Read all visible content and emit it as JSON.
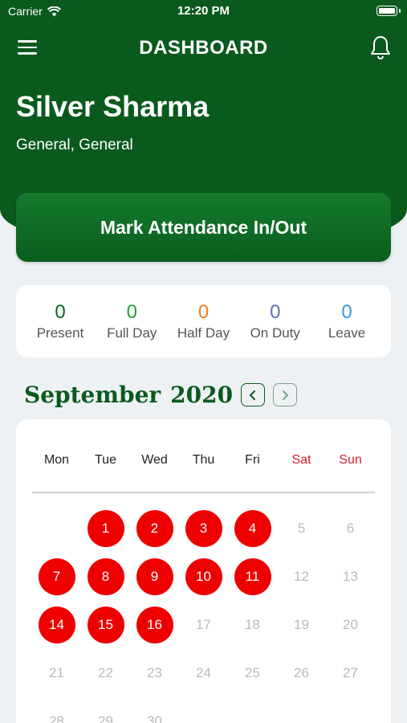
{
  "status_bar": {
    "carrier": "Carrier",
    "time": "12:20 PM"
  },
  "nav": {
    "title": "DASHBOARD",
    "menu_icon": "hamburger-menu-icon",
    "notify_icon": "bell-icon"
  },
  "user": {
    "name": "Silver Sharma",
    "subtitle": "General,  General"
  },
  "attendance_button": "Mark Attendance In/Out",
  "stats": [
    {
      "value": "0",
      "label": "Present",
      "color": "#0a6b22"
    },
    {
      "value": "0",
      "label": "Full Day",
      "color": "#1aa33a"
    },
    {
      "value": "0",
      "label": "Half Day",
      "color": "#f07d1a"
    },
    {
      "value": "0",
      "label": "On Duty",
      "color": "#5a6fbf"
    },
    {
      "value": "0",
      "label": "Leave",
      "color": "#3a9bd8"
    }
  ],
  "calendar": {
    "month_label": "September",
    "year_label": "2020",
    "weekdays": [
      "Mon",
      "Tue",
      "Wed",
      "Thu",
      "Fri",
      "Sat",
      "Sun"
    ],
    "weeks": [
      [
        "",
        "1",
        "2",
        "3",
        "4",
        "5",
        "6"
      ],
      [
        "7",
        "8",
        "9",
        "10",
        "11",
        "12",
        "13"
      ],
      [
        "14",
        "15",
        "16",
        "17",
        "18",
        "19",
        "20"
      ],
      [
        "21",
        "22",
        "23",
        "24",
        "25",
        "26",
        "27"
      ],
      [
        "28",
        "29",
        "30",
        "",
        "",
        "",
        ""
      ]
    ],
    "absent_days": [
      "1",
      "2",
      "3",
      "4",
      "7",
      "8",
      "9",
      "10",
      "11",
      "14",
      "15",
      "16"
    ],
    "absent_color": "#ef0000",
    "weekend_color": "#d0202a"
  },
  "colors": {
    "primary": "#0a5a1e",
    "background": "#eef1f4"
  }
}
